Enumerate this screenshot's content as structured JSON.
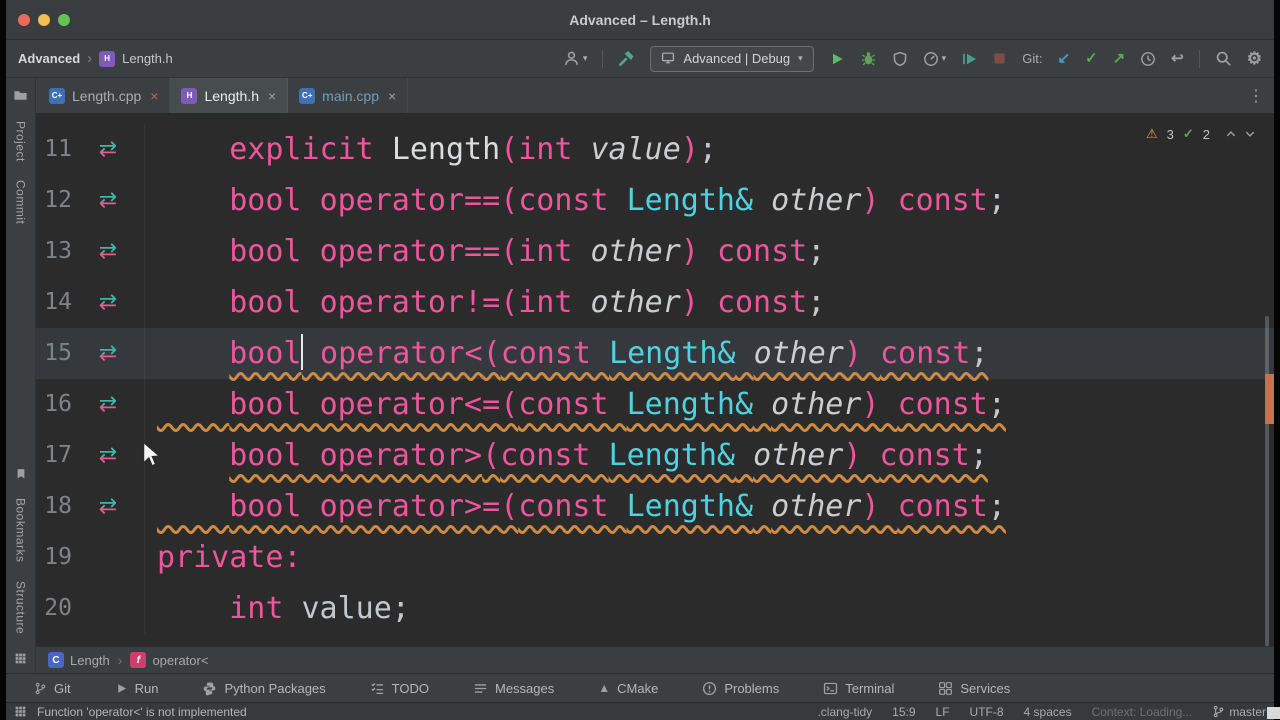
{
  "window": {
    "title": "Advanced – Length.h"
  },
  "colors": {
    "keyword": "#ed559c",
    "classname": "#4fd2e0",
    "param": "#cbcdcf",
    "plain": "#c4c8cc",
    "ctor": "#dadcde",
    "warn_squiggle": "#cd8b43",
    "current_line": "#35393d",
    "warning_icon": "#e9a33f",
    "success_icon": "#57aa4f",
    "panel": "#3c3f41",
    "editor_bg": "#2b2b2b",
    "titlebar_bg": "#3a3d3f",
    "traffic_red": "#ec6a5e",
    "traffic_yellow": "#f4bf4f",
    "traffic_green": "#61c454",
    "marker_top": "#3fb6a8",
    "marker_bottom": "#e35b8f",
    "scroll_mark": "#c3744d",
    "modified_file": "#6e9fc0"
  },
  "toolbar": {
    "project": "Advanced",
    "file": "Length.h",
    "git_label": "Git:"
  },
  "toolbar_actions": [
    {
      "name": "user-avatar-button",
      "icon": "person",
      "color": "#9da0a3",
      "caret": true
    },
    {
      "name": "toolbar-separator",
      "sep": true
    },
    {
      "name": "build-button",
      "icon": "hammer",
      "color": "#4fa886"
    },
    {
      "name": "run-config-select",
      "combo": true,
      "label": "Advanced | Debug"
    },
    {
      "name": "run-button",
      "icon": "play",
      "color": "#5fb865"
    },
    {
      "name": "debug-button",
      "icon": "bug",
      "color": "#62a35c"
    },
    {
      "name": "coverage-button",
      "icon": "shield",
      "color": "#9da0a3"
    },
    {
      "name": "profiler-button",
      "icon": "gauge",
      "color": "#9da0a3",
      "caret": true
    },
    {
      "name": "attach-button",
      "icon": "attach",
      "color": "#45a08b"
    },
    {
      "name": "stop-button",
      "icon": "stop",
      "color": "#7e4b46"
    },
    {
      "name": "git-label",
      "label": "Git:"
    },
    {
      "name": "git-update-button",
      "glyph": "↙",
      "color": "#4596c8"
    },
    {
      "name": "git-commit-button",
      "glyph": "✓",
      "color": "#57aa4f"
    },
    {
      "name": "git-push-button",
      "glyph": "↗",
      "color": "#57aa4f"
    },
    {
      "name": "history-button",
      "icon": "clock",
      "color": "#9da0a3"
    },
    {
      "name": "rollback-button",
      "glyph": "↩",
      "color": "#9da0a3"
    },
    {
      "name": "toolbar-separator",
      "sep": true
    },
    {
      "name": "search-everywhere-button",
      "icon": "search",
      "color": "#9da0a3"
    },
    {
      "name": "settings-button",
      "glyph": "⚙",
      "color": "#9da0a3"
    }
  ],
  "tabs": [
    {
      "label": "Length.cpp",
      "kind": "cpp",
      "active": false,
      "close_color": "#c75e58",
      "label_color": "#a9adb0"
    },
    {
      "label": "Length.h",
      "kind": "h",
      "active": true,
      "close_color": "#9da0a3",
      "label_color": "#eceeef"
    },
    {
      "label": "main.cpp",
      "kind": "cpp",
      "active": false,
      "close_color": "#9da0a3",
      "label_color": "#6e9fc0"
    }
  ],
  "stripe": {
    "top": [
      {
        "name": "project-toolwindow-icon",
        "icon": "folder"
      },
      {
        "name": "stripe-project",
        "label": "Project"
      },
      {
        "name": "stripe-commit",
        "label": "Commit"
      }
    ],
    "bottom": [
      {
        "name": "bookmark-toolwindow-icon",
        "icon": "bookmark"
      },
      {
        "name": "stripe-bookmarks",
        "label": "Bookmarks"
      },
      {
        "name": "stripe-structure",
        "label": "Structure"
      },
      {
        "name": "toolwindow-grid-icon",
        "icon": "grid"
      }
    ]
  },
  "inspections": {
    "warnings": "3",
    "weak": "2"
  },
  "editor": {
    "lines": [
      {
        "num": "11",
        "marker": true,
        "indent": 4,
        "warn": false,
        "warn_full": false,
        "current": false,
        "tokens": [
          {
            "s": "k",
            "t": "explicit "
          },
          {
            "s": "c",
            "t": "Length"
          },
          {
            "s": "k",
            "t": "("
          },
          {
            "s": "k",
            "t": "int "
          },
          {
            "s": "p",
            "t": "value"
          },
          {
            "s": "k",
            "t": ")"
          },
          {
            "s": "n",
            "t": ";"
          }
        ]
      },
      {
        "num": "12",
        "marker": true,
        "indent": 4,
        "warn": false,
        "warn_full": false,
        "current": false,
        "tokens": [
          {
            "s": "k",
            "t": "bool "
          },
          {
            "s": "k",
            "t": "operator=="
          },
          {
            "s": "k",
            "t": "("
          },
          {
            "s": "k",
            "t": "const "
          },
          {
            "s": "y",
            "t": "Length&"
          },
          {
            "s": "n",
            "t": " "
          },
          {
            "s": "p",
            "t": "other"
          },
          {
            "s": "k",
            "t": ") "
          },
          {
            "s": "k",
            "t": "const"
          },
          {
            "s": "n",
            "t": ";"
          }
        ]
      },
      {
        "num": "13",
        "marker": true,
        "indent": 4,
        "warn": false,
        "warn_full": false,
        "current": false,
        "tokens": [
          {
            "s": "k",
            "t": "bool "
          },
          {
            "s": "k",
            "t": "operator=="
          },
          {
            "s": "k",
            "t": "("
          },
          {
            "s": "k",
            "t": "int "
          },
          {
            "s": "p",
            "t": "other"
          },
          {
            "s": "k",
            "t": ") "
          },
          {
            "s": "k",
            "t": "const"
          },
          {
            "s": "n",
            "t": ";"
          }
        ]
      },
      {
        "num": "14",
        "marker": true,
        "indent": 4,
        "warn": false,
        "warn_full": false,
        "current": false,
        "tokens": [
          {
            "s": "k",
            "t": "bool "
          },
          {
            "s": "k",
            "t": "operator!="
          },
          {
            "s": "k",
            "t": "("
          },
          {
            "s": "k",
            "t": "int "
          },
          {
            "s": "p",
            "t": "other"
          },
          {
            "s": "k",
            "t": ") "
          },
          {
            "s": "k",
            "t": "const"
          },
          {
            "s": "n",
            "t": ";"
          }
        ]
      },
      {
        "num": "15",
        "marker": true,
        "indent": 4,
        "warn": true,
        "warn_full": false,
        "current": true,
        "tokens": [
          {
            "s": "k",
            "t": "bool"
          },
          {
            "caret": true
          },
          {
            "s": "k",
            "t": " operator<"
          },
          {
            "s": "k",
            "t": "("
          },
          {
            "s": "k",
            "t": "const "
          },
          {
            "s": "y",
            "t": "Length&"
          },
          {
            "s": "n",
            "t": " "
          },
          {
            "s": "p",
            "t": "other"
          },
          {
            "s": "k",
            "t": ") "
          },
          {
            "s": "k",
            "t": "const"
          },
          {
            "s": "n",
            "t": ";"
          }
        ]
      },
      {
        "num": "16",
        "marker": true,
        "indent": 4,
        "warn": true,
        "warn_full": true,
        "current": false,
        "tokens": [
          {
            "s": "k",
            "t": "bool "
          },
          {
            "s": "k",
            "t": "operator<="
          },
          {
            "s": "k",
            "t": "("
          },
          {
            "s": "k",
            "t": "const "
          },
          {
            "s": "y",
            "t": "Length&"
          },
          {
            "s": "n",
            "t": " "
          },
          {
            "s": "p",
            "t": "other"
          },
          {
            "s": "k",
            "t": ") "
          },
          {
            "s": "k",
            "t": "const"
          },
          {
            "s": "n",
            "t": ";"
          }
        ]
      },
      {
        "num": "17",
        "marker": true,
        "indent": 4,
        "warn": true,
        "warn_full": false,
        "current": false,
        "tokens": [
          {
            "s": "k",
            "t": "bool "
          },
          {
            "s": "k",
            "t": "operator>"
          },
          {
            "s": "k",
            "t": "("
          },
          {
            "s": "k",
            "t": "const "
          },
          {
            "s": "y",
            "t": "Length&"
          },
          {
            "s": "n",
            "t": " "
          },
          {
            "s": "p",
            "t": "other"
          },
          {
            "s": "k",
            "t": ") "
          },
          {
            "s": "k",
            "t": "const"
          },
          {
            "s": "n",
            "t": ";"
          }
        ]
      },
      {
        "num": "18",
        "marker": true,
        "indent": 4,
        "warn": true,
        "warn_full": true,
        "current": false,
        "tokens": [
          {
            "s": "k",
            "t": "bool "
          },
          {
            "s": "k",
            "t": "operator>="
          },
          {
            "s": "k",
            "t": "("
          },
          {
            "s": "k",
            "t": "const "
          },
          {
            "s": "y",
            "t": "Length&"
          },
          {
            "s": "n",
            "t": " "
          },
          {
            "s": "p",
            "t": "other"
          },
          {
            "s": "k",
            "t": ") "
          },
          {
            "s": "k",
            "t": "const"
          },
          {
            "s": "n",
            "t": ";"
          }
        ]
      },
      {
        "num": "19",
        "marker": false,
        "indent": 0,
        "warn": false,
        "warn_full": false,
        "current": false,
        "tokens": [
          {
            "s": "k",
            "t": "private:"
          }
        ]
      },
      {
        "num": "20",
        "marker": false,
        "indent": 4,
        "warn": false,
        "warn_full": false,
        "current": false,
        "tokens": [
          {
            "s": "k",
            "t": "int "
          },
          {
            "s": "n",
            "t": "value;"
          }
        ]
      }
    ]
  },
  "breadcrumbs": [
    {
      "type": "class",
      "label": "Length"
    },
    {
      "type": "function",
      "label": "operator<"
    }
  ],
  "bottom_bar": [
    {
      "name": "toolwindow-git",
      "icon": "branch",
      "label": "Git"
    },
    {
      "name": "toolwindow-run",
      "icon": "playsmall",
      "label": "Run"
    },
    {
      "name": "toolwindow-python-packages",
      "icon": "python",
      "label": "Python Packages"
    },
    {
      "name": "toolwindow-todo",
      "icon": "checklist",
      "label": "TODO"
    },
    {
      "name": "toolwindow-messages",
      "icon": "lines3",
      "label": "Messages"
    },
    {
      "name": "toolwindow-cmake",
      "glyph": "▲",
      "label": "CMake"
    },
    {
      "name": "toolwindow-problems",
      "icon": "problems",
      "label": "Problems"
    },
    {
      "name": "toolwindow-terminal",
      "icon": "terminal",
      "label": "Terminal"
    },
    {
      "name": "toolwindow-services",
      "icon": "services",
      "label": "Services"
    }
  ],
  "status": {
    "message": "Function 'operator<' is not implemented",
    "right": [
      ".clang-tidy",
      "15:9",
      "LF",
      "UTF-8",
      "4 spaces"
    ],
    "context": "Context: Loading...",
    "branch": "master"
  }
}
